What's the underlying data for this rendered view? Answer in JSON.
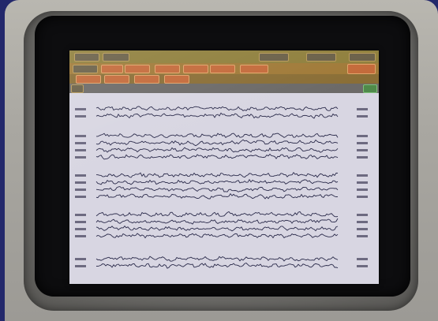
{
  "colors": {
    "background": "#23286b",
    "bezel": "#aeaca6",
    "screen": "#d8d6e2",
    "trace": "#2a2a4a",
    "menu_button": "#c46a3a"
  },
  "eeg": {
    "channel_count": 16,
    "channel_groups": [
      2,
      4,
      4,
      4,
      2
    ]
  }
}
